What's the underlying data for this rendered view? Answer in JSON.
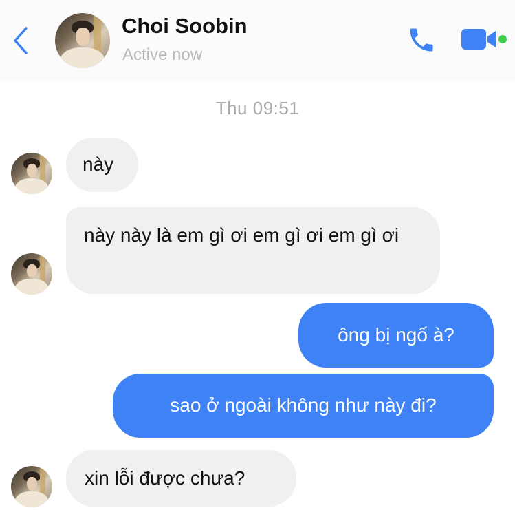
{
  "header": {
    "contact_name": "Choi Soobin",
    "status": "Active now",
    "icons": [
      "chevron-left-icon",
      "phone-icon",
      "video-camera-icon"
    ],
    "accent_color": "#3f82f6",
    "active_dot_color": "#3bcd4b"
  },
  "conversation": {
    "timestamp": "Thu 09:51",
    "messages": [
      {
        "sender": "contact",
        "text": "này"
      },
      {
        "sender": "contact",
        "text": "này này là em gì ơi em gì ơi em gì ơi"
      },
      {
        "sender": "me",
        "text": "ông bị ngố à?"
      },
      {
        "sender": "me",
        "text": "sao ở ngoài không như này đi?"
      },
      {
        "sender": "contact",
        "text": "xin lỗi được chưa?"
      }
    ],
    "incoming_bubble_color": "#f0f0f0",
    "outgoing_bubble_color": "#3f82f6"
  }
}
